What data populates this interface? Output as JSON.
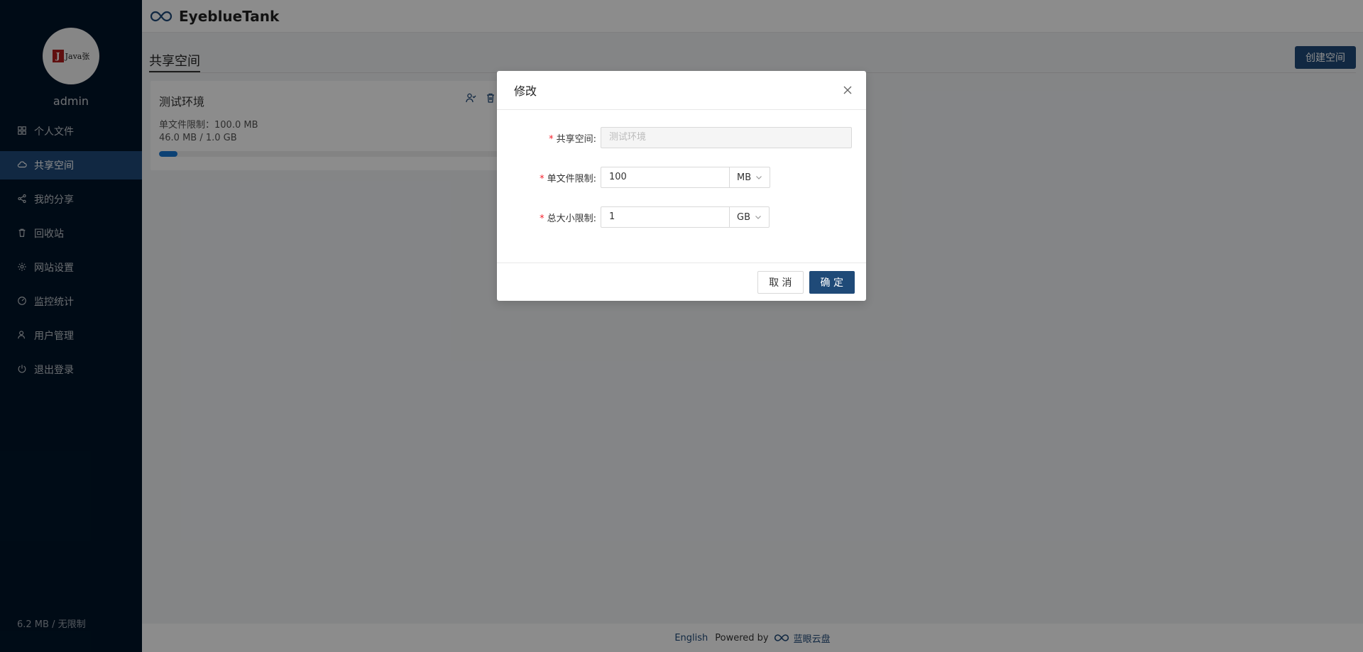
{
  "sidebar": {
    "avatar_text": "Java张",
    "username": "admin",
    "items": [
      {
        "label": "个人文件"
      },
      {
        "label": "共享空间"
      },
      {
        "label": "我的分享"
      },
      {
        "label": "回收站"
      },
      {
        "label": "网站设置"
      },
      {
        "label": "监控统计"
      },
      {
        "label": "用户管理"
      },
      {
        "label": "退出登录"
      }
    ],
    "active_index": 1,
    "usage": "6.2 MB / 无限制"
  },
  "header": {
    "title": "EyeblueTank"
  },
  "main": {
    "page_title": "共享空间",
    "create_button": "创建空间",
    "space_card": {
      "name": "测试环境",
      "file_limit": "单文件限制：100.0 MB",
      "usage": "46.0 MB / 1.0 GB",
      "progress": 0.045
    }
  },
  "footer": {
    "lang": "English",
    "powered_by": "Powered by",
    "brand": "蓝眼云盘"
  },
  "modal": {
    "title": "修改",
    "fields": {
      "space_label": "共享空间:",
      "space_value": "测试环境",
      "file_limit_label": "单文件限制:",
      "file_limit_value": "100",
      "file_limit_unit": "MB",
      "total_limit_label": "总大小限制:",
      "total_limit_value": "1",
      "total_limit_unit": "GB"
    },
    "cancel": "取 消",
    "ok": "确 定"
  },
  "colors": {
    "sidebar_bg": "#001529",
    "accent": "#1f4a78",
    "progress": "#1677d4"
  }
}
